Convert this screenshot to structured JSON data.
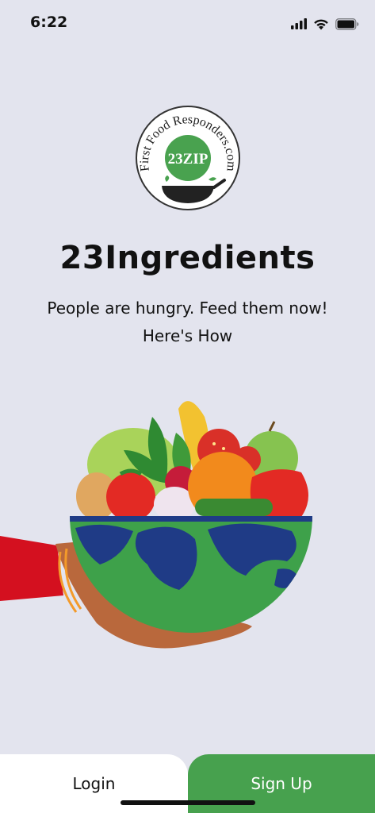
{
  "status": {
    "time": "6:22"
  },
  "logo": {
    "arc_text": "First Food Responders.com",
    "badge_text": "23ZIP"
  },
  "title": "23Ingredients",
  "tagline": "People are hungry. Feed them now!",
  "subtagline": "Here's How",
  "buttons": {
    "login": "Login",
    "signup": "Sign Up"
  },
  "colors": {
    "background": "#e3e4ee",
    "accent": "#47a14e",
    "login_bg": "#ffffff"
  }
}
